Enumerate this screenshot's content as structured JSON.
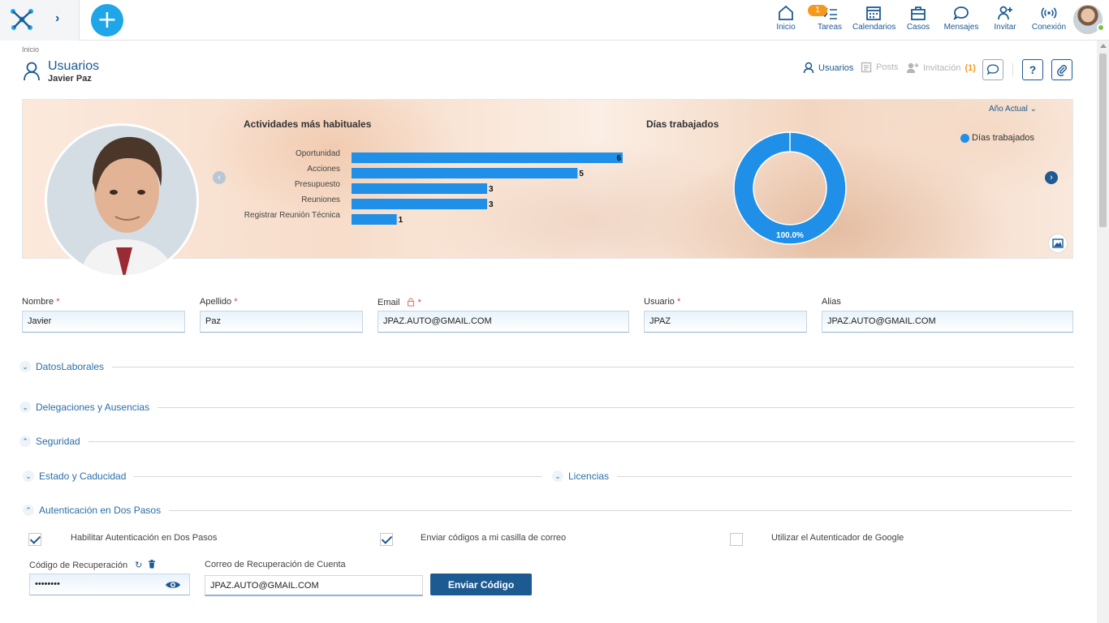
{
  "nav": {
    "items": [
      {
        "key": "inicio",
        "label": "Inicio",
        "icon": "home-icon"
      },
      {
        "key": "tareas",
        "label": "Tareas",
        "icon": "tasks-icon",
        "badge": "1"
      },
      {
        "key": "calendarios",
        "label": "Calendarios",
        "icon": "calendar-icon"
      },
      {
        "key": "casos",
        "label": "Casos",
        "icon": "briefcase-icon"
      },
      {
        "key": "mensajes",
        "label": "Mensajes",
        "icon": "chat-icon"
      },
      {
        "key": "invitar",
        "label": "Invitar",
        "icon": "add-user-icon"
      },
      {
        "key": "conexion",
        "label": "Conexión",
        "icon": "signal-icon"
      }
    ]
  },
  "header": {
    "breadcrumb": "Inicio",
    "title": "Usuarios",
    "subtitle": "Javier Paz",
    "tabs": {
      "usuarios": "Usuarios",
      "posts": "Posts",
      "invitacion": "Invitación",
      "invitacion_count": "(1)"
    },
    "help_label": "?"
  },
  "banner": {
    "year_select": "Año Actual",
    "legend": "Días trabajados"
  },
  "chart_data": [
    {
      "type": "bar",
      "title": "Actividades más habituales",
      "categories": [
        "Oportunidad",
        "Acciones",
        "Presupuesto",
        "Reuniones",
        "Registrar Reunión Técnica"
      ],
      "values": [
        6,
        5,
        3,
        3,
        1
      ],
      "color": "#1f8fe8"
    },
    {
      "type": "pie",
      "title": "Días trabajados",
      "series": [
        {
          "name": "Días trabajados",
          "values": [
            100
          ]
        }
      ],
      "data_label": "100.0%",
      "color": "#1f8fe8"
    }
  ],
  "form": {
    "nombre": {
      "label": "Nombre",
      "value": "Javier"
    },
    "apellido": {
      "label": "Apellido",
      "value": "Paz"
    },
    "email": {
      "label": "Email",
      "value": "JPAZ.AUTO@GMAIL.COM"
    },
    "usuario": {
      "label": "Usuario",
      "value": "JPAZ"
    },
    "alias": {
      "label": "Alias",
      "value": "JPAZ.AUTO@GMAIL.COM"
    },
    "required_mark": "*"
  },
  "sections": {
    "datos_laborales": "DatosLaborales",
    "delegaciones": "Delegaciones y Ausencias",
    "seguridad": "Seguridad",
    "estado": "Estado y Caducidad",
    "licencias": "Licencias",
    "autenticacion": "Autenticación en Dos Pasos"
  },
  "two_factor": {
    "enable": {
      "label": "Habilitar Autenticación en Dos Pasos",
      "checked": true
    },
    "email_codes": {
      "label": "Enviar códigos a mi casilla de correo",
      "checked": true
    },
    "google_auth": {
      "label": "Utilizar el Autenticador de Google",
      "checked": false
    },
    "recovery_code_label": "Código de Recuperación",
    "recovery_code_value": "••••••••",
    "recovery_email_label": "Correo de Recuperación de Cuenta",
    "recovery_email_value": "JPAZ.AUTO@GMAIL.COM",
    "send_button": "Enviar Código"
  },
  "colors": {
    "primary": "#1d5a92",
    "accent": "#1fa6e8",
    "chart": "#1f8fe8",
    "badge": "#f39a1e",
    "required": "#e03b3b"
  }
}
